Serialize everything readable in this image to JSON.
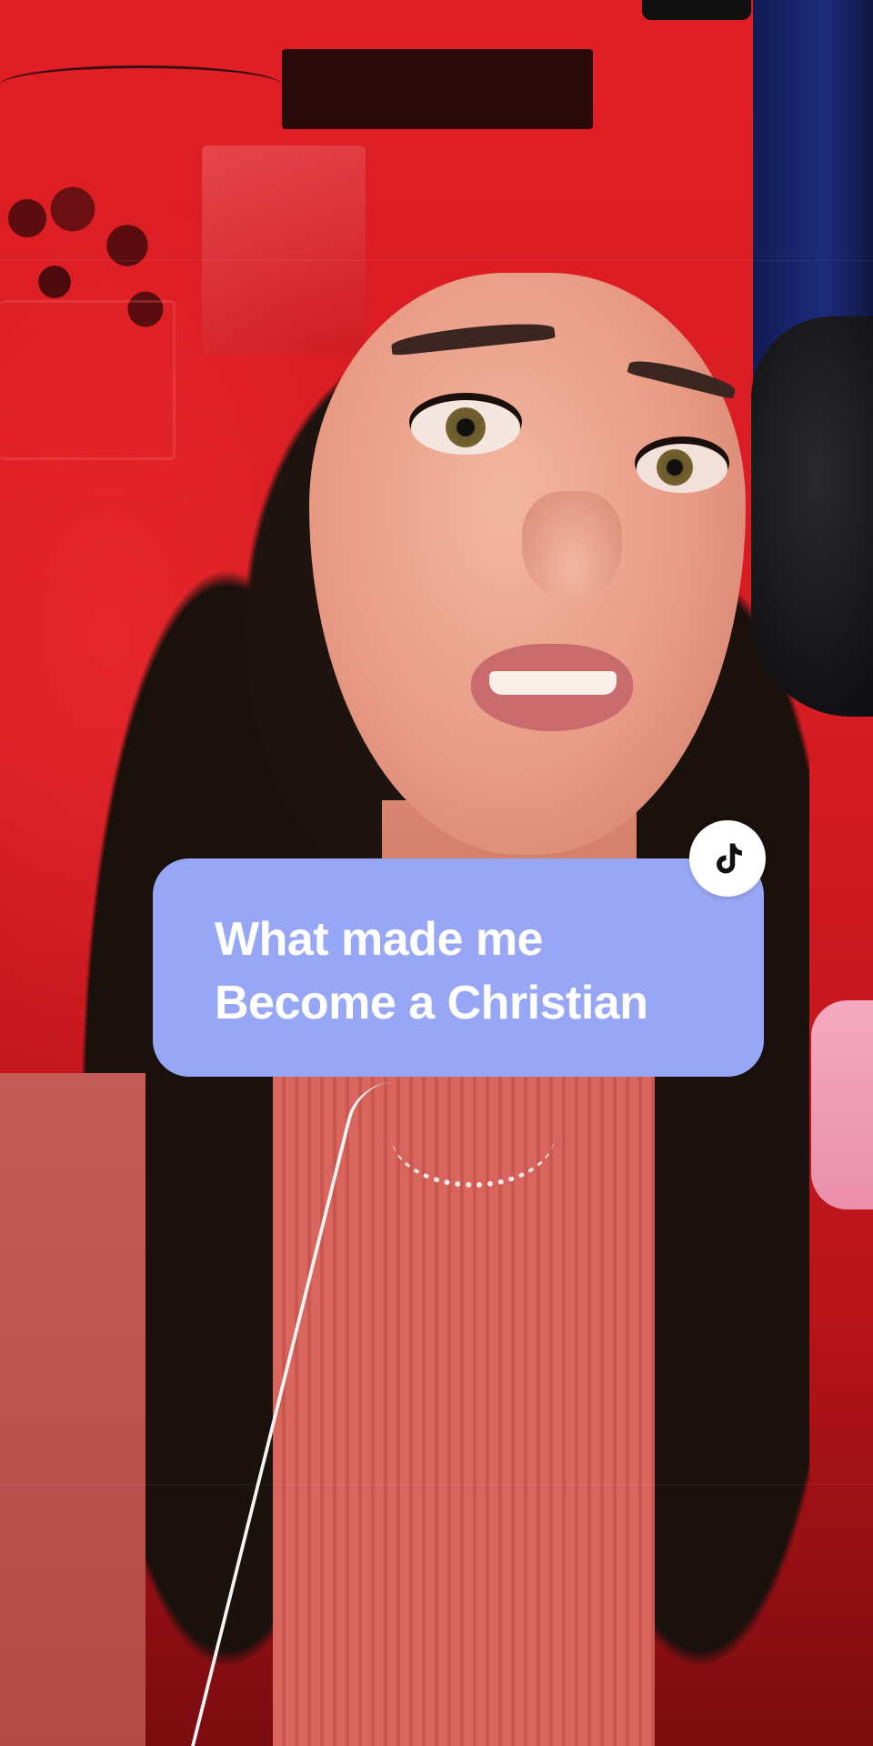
{
  "overlay": {
    "title_lines": [
      "What made me",
      "Become a Christian"
    ],
    "card_color": "#98a7f5",
    "text_color": "#ffffff"
  },
  "badge": {
    "icon": "tiktok-logo-icon",
    "background": "#ffffff",
    "icon_color": "#111111"
  },
  "scene": {
    "background_color": "#d6222a"
  }
}
